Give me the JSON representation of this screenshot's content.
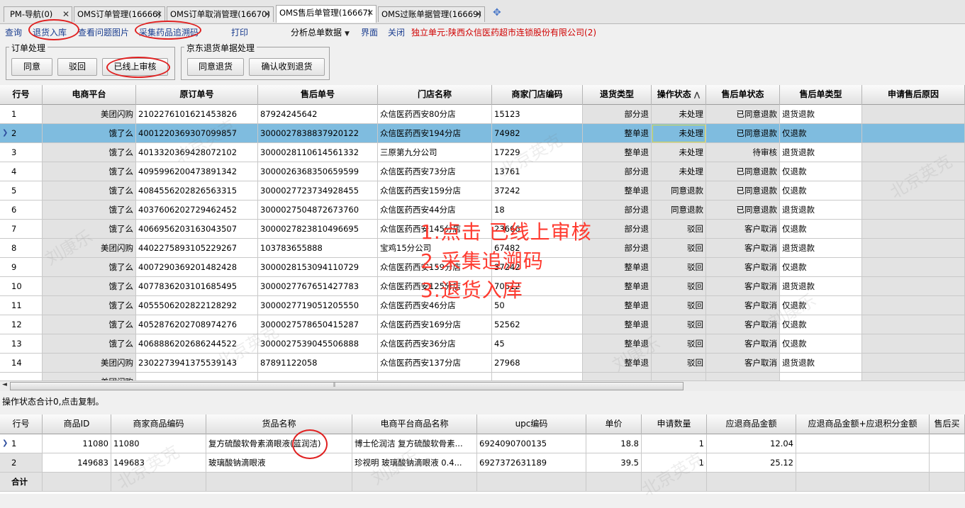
{
  "tabs": [
    {
      "label": "PM-导航(0)"
    },
    {
      "label": "OMS订单管理(16666)"
    },
    {
      "label": "OMS订单取消管理(16670)"
    },
    {
      "label": "OMS售后单管理(16667)"
    },
    {
      "label": "OMS过账单据管理(16669)"
    }
  ],
  "toolbar": {
    "query": "查询",
    "return_in": "退货入库",
    "view_images": "查看问题图片",
    "collect_trace": "采集药品追溯码",
    "print": "打印",
    "analyze": "分析总单数据",
    "interface": "界面",
    "close": "关闭",
    "unit": "独立单元:陕西众信医药超市连锁股份有限公司(2)"
  },
  "order_group": {
    "title": "订单处理",
    "agree": "同意",
    "reject": "驳回",
    "online_audited": "已线上审核"
  },
  "jd_group": {
    "title": "京东退货单据处理",
    "agree_return": "同意退货",
    "confirm_received": "确认收到退货"
  },
  "main_grid": {
    "columns": [
      "行号",
      "电商平台",
      "原订单号",
      "售后单号",
      "门店名称",
      "商家门店编码",
      "退货类型",
      "操作状态",
      "售后单状态",
      "售后单类型",
      "申请售后原因"
    ],
    "rows": [
      [
        "1",
        "美团闪购",
        "2102276101621453826",
        "87924245642",
        "众信医药西安80分店",
        "15123",
        "部分退",
        "未处理",
        "已同意退款",
        "退货退款"
      ],
      [
        "2",
        "饿了么",
        "4001220369307099857",
        "3000027838837920122",
        "众信医药西安194分店",
        "74982",
        "整单退",
        "未处理",
        "已同意退款",
        "仅退款"
      ],
      [
        "3",
        "饿了么",
        "4013320369428072102",
        "3000028110614561332",
        "三原第九分公司",
        "17229",
        "整单退",
        "未处理",
        "待审核",
        "退货退款"
      ],
      [
        "4",
        "饿了么",
        "4095996200473891342",
        "3000026368350659599",
        "众信医药西安73分店",
        "13761",
        "部分退",
        "未处理",
        "已同意退款",
        "仅退款"
      ],
      [
        "5",
        "饿了么",
        "4084556202826563315",
        "3000027723734928455",
        "众信医药西安159分店",
        "37242",
        "整单退",
        "同意退款",
        "已同意退款",
        "仅退款"
      ],
      [
        "6",
        "饿了么",
        "4037606202729462452",
        "3000027504872673760",
        "众信医药西安44分店",
        "18",
        "部分退",
        "同意退款",
        "已同意退款",
        "退货退款"
      ],
      [
        "7",
        "饿了么",
        "4066956203163043507",
        "3000027823810496695",
        "众信医药西安145分店",
        "23666",
        "部分退",
        "驳回",
        "客户取消",
        "仅退款"
      ],
      [
        "8",
        "美团闪购",
        "4402275893105229267",
        "103783655888",
        "宝鸡15分公司",
        "67482",
        "部分退",
        "驳回",
        "客户取消",
        "退货退款"
      ],
      [
        "9",
        "饿了么",
        "4007290369201482428",
        "3000028153094110729",
        "众信医药西安159分店",
        "37242",
        "整单退",
        "驳回",
        "客户取消",
        "仅退款"
      ],
      [
        "10",
        "饿了么",
        "4077836203101685495",
        "3000027767651427783",
        "众信医药西安125分店",
        "70612",
        "整单退",
        "驳回",
        "客户取消",
        "退货退款"
      ],
      [
        "11",
        "饿了么",
        "4055506202822128292",
        "3000027719051205550",
        "众信医药西安46分店",
        "50",
        "整单退",
        "驳回",
        "客户取消",
        "仅退款"
      ],
      [
        "12",
        "饿了么",
        "4052876202708974276",
        "3000027578650415287",
        "众信医药西安169分店",
        "52562",
        "整单退",
        "驳回",
        "客户取消",
        "仅退款"
      ],
      [
        "13",
        "饿了么",
        "4068886202686244522",
        "3000027539045506888",
        "众信医药西安36分店",
        "45",
        "整单退",
        "驳回",
        "客户取消",
        "仅退款"
      ],
      [
        "14",
        "美团闪购",
        "2302273941375539143",
        "87891122058",
        "众信医药西安137分店",
        "27968",
        "整单退",
        "驳回",
        "客户取消",
        "退货退款"
      ]
    ],
    "partial_row": "美团闪购",
    "sort_icon": "sort-up-icon"
  },
  "status_text": "操作状态合计0,点击复制。",
  "detail_grid": {
    "columns": [
      "行号",
      "商品ID",
      "商家商品编码",
      "货品名称",
      "电商平台商品名称",
      "upc编码",
      "单价",
      "申请数量",
      "应退商品金额",
      "应退商品金额+应退积分金额",
      "售后买"
    ],
    "rows": [
      [
        "1",
        "11080",
        "11080",
        "复方硫酸软骨素滴眼液(蓝润洁)",
        "博士伦润洁 复方硫酸软骨素...",
        "6924090700135",
        "18.8",
        "1",
        "12.04",
        ""
      ],
      [
        "2",
        "149683",
        "149683",
        "玻璃酸钠滴眼液",
        "珍视明 玻璃酸钠滴眼液 0.4...",
        "6927372631189",
        "39.5",
        "1",
        "25.12",
        ""
      ]
    ],
    "total_label": "合计"
  },
  "annotations": [
    "1.点击 已线上审核",
    "2.采集追溯码",
    "3.退货入库"
  ],
  "watermark": [
    "北京英克",
    "刘康乐"
  ],
  "colors": {
    "selected_row": "#7fbcdf",
    "annotation": "#ff3b30",
    "unit_text": "#d00000"
  }
}
